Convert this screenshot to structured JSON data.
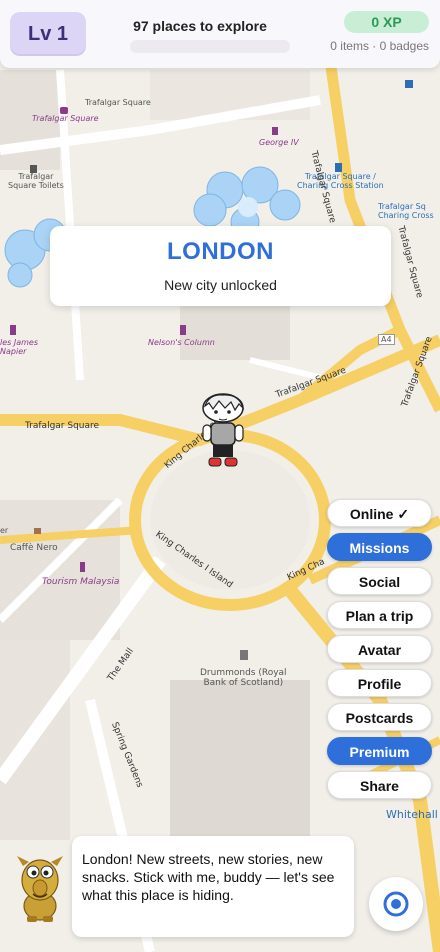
{
  "header": {
    "level": "Lv 1",
    "places": "97 places to explore",
    "xp": "0 XP",
    "inventory": "0 items · 0 badges"
  },
  "city_card": {
    "name": "LONDON",
    "subtitle": "New city unlocked"
  },
  "map_labels": {
    "trafalgar_sq_top": "Trafalgar Square",
    "trafalgar_sq_purple": "Trafalgar Square",
    "george_iv": "George IV",
    "toilets": "Trafalgar\nSquare Toilets",
    "station": "Trafalgar Square /\nCharing Cross Station",
    "station_right": "Trafalgar Sq\nCharing Cross",
    "nelson": "Nelson's Column",
    "james": "les James\nNapier",
    "a4": "A4",
    "cafe_nero": "Caffè Nero",
    "tourism": "Tourism Malaysia",
    "drummonds": "Drummonds (Royal\nBank of Scotland)",
    "whitehall": "Whitehall",
    "trafalgar_sq_road_left": "Trafalgar Square",
    "trafalgar_sq_road_right": "Trafalgar Square",
    "trafalgar_sq_road_vertical": "Trafalgar Square",
    "trafalgar_sq_road_vertical2": "Trafalgar Square",
    "trafalgar_sq_road_vertical3": "Trafalgar Square",
    "king_charles_st": "King Charles St",
    "king_charles_island": "King Charles I Island",
    "king_charles_right": "King Cha",
    "the_mall": "The Mall",
    "spring_gardens": "Spring Gardens",
    "er": "er"
  },
  "menu": [
    {
      "label": "Online ✓",
      "active": false
    },
    {
      "label": "Missions",
      "active": true
    },
    {
      "label": "Social",
      "active": false
    },
    {
      "label": "Plan a trip",
      "active": false
    },
    {
      "label": "Avatar",
      "active": false
    },
    {
      "label": "Profile",
      "active": false
    },
    {
      "label": "Postcards",
      "active": false
    },
    {
      "label": "Premium",
      "active": true
    },
    {
      "label": "Share",
      "active": false
    }
  ],
  "speech": {
    "text": "London! New streets, new stories, new snacks. Stick with me, buddy — let's see what this place is hiding."
  },
  "colors": {
    "accent": "#2f6fd9",
    "road_yellow": "#f6cf65",
    "water": "#aad3f5",
    "xp_green": "#2a9a55"
  }
}
